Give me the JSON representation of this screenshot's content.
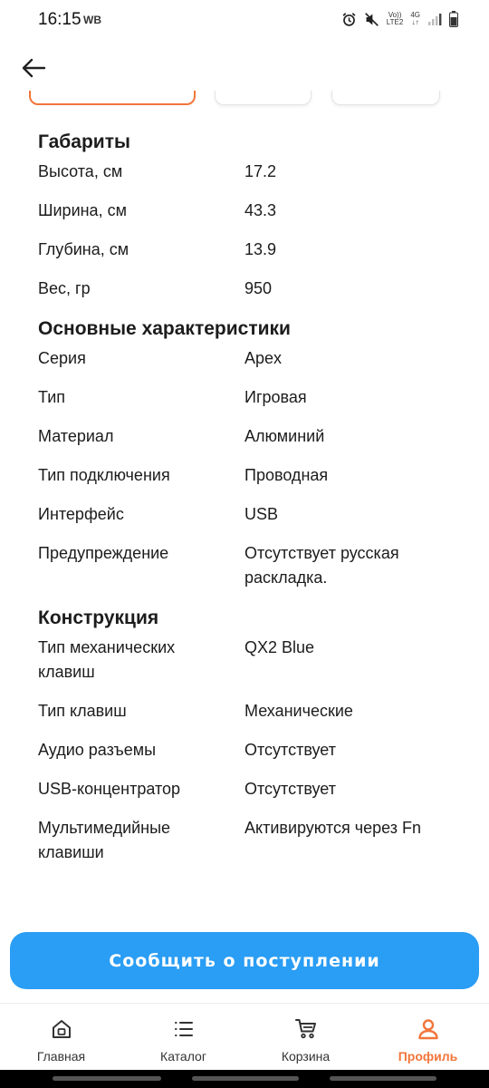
{
  "status_bar": {
    "time": "16:15",
    "carrier_badge": "WB",
    "volte_top": "Vo))",
    "volte_bottom": "LTE2",
    "network": "4G",
    "network_arrows": "↓↑"
  },
  "specs": {
    "sections": [
      {
        "title": "Габариты",
        "rows": [
          {
            "key": "Высота, см",
            "value": "17.2"
          },
          {
            "key": "Ширина, см",
            "value": "43.3"
          },
          {
            "key": "Глубина, см",
            "value": "13.9"
          },
          {
            "key": "Вес, гр",
            "value": "950"
          }
        ]
      },
      {
        "title": "Основные характеристики",
        "rows": [
          {
            "key": "Серия",
            "value": "Apex"
          },
          {
            "key": "Тип",
            "value": "Игровая"
          },
          {
            "key": "Материал",
            "value": "Алюминий"
          },
          {
            "key": "Тип подключения",
            "value": "Проводная"
          },
          {
            "key": "Интерфейс",
            "value": "USB"
          },
          {
            "key": "Предупреждение",
            "value": "Отсутствует русская раскладка."
          }
        ]
      },
      {
        "title": "Конструкция",
        "rows": [
          {
            "key": "Тип механических клавиш",
            "value": "QX2 Blue"
          },
          {
            "key": "Тип клавиш",
            "value": "Механические"
          },
          {
            "key": "Аудио разъемы",
            "value": "Отсутствует"
          },
          {
            "key": "USB-концентратор",
            "value": "Отсутствует"
          },
          {
            "key": "Мультимедийные клавиши",
            "value": "Активируются через Fn"
          }
        ]
      }
    ]
  },
  "cta": {
    "label": "Сообщить о поступлении"
  },
  "bottom_nav": {
    "items": [
      {
        "label": "Главная",
        "icon": "home-icon"
      },
      {
        "label": "Каталог",
        "icon": "catalog-icon"
      },
      {
        "label": "Корзина",
        "icon": "cart-icon"
      },
      {
        "label": "Профиль",
        "icon": "profile-icon",
        "active": true
      }
    ]
  },
  "colors": {
    "accent_orange": "#f2753a",
    "cta_blue": "#2a9df4"
  }
}
